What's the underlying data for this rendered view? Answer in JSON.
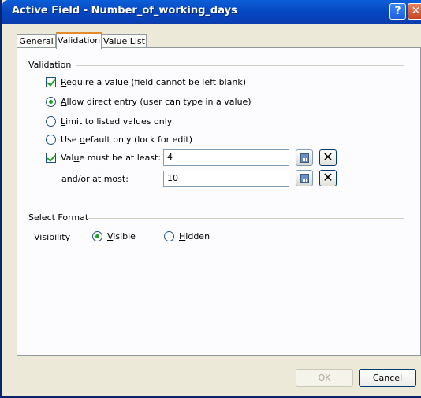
{
  "window": {
    "title": "Active Field - Number_of_working_days",
    "help_label": "?",
    "close_label": "✕"
  },
  "tabs": [
    {
      "label": "General",
      "active": false
    },
    {
      "label": "Validation",
      "active": true
    },
    {
      "label": "Value List",
      "active": false
    }
  ],
  "validation": {
    "group_label": "Validation",
    "require_value": {
      "first": "R",
      "rest": "equire a value (field cannot be left blank)",
      "checked": true
    },
    "allow_direct": {
      "first": "A",
      "rest": "llow direct entry (user can type in a value)",
      "checked": true
    },
    "limit_listed": {
      "first": "L",
      "rest": "imit to listed values only",
      "checked": false
    },
    "use_default": {
      "first": "Use ",
      "underlined": "d",
      "rest": "efault only (lock for edit)",
      "checked": false
    },
    "min_value": {
      "first": "Val",
      "underlined": "u",
      "rest": "e must be at least:",
      "checked": true,
      "value": "4"
    },
    "max_value": {
      "label": "and/or at most:",
      "value": "10"
    }
  },
  "format": {
    "group_label": "Select Format",
    "visibility_label": "Visibility",
    "visible": {
      "underlined": "V",
      "rest": "isible",
      "checked": true
    },
    "hidden": {
      "underlined": "H",
      "rest": "idden",
      "checked": false
    }
  },
  "buttons": {
    "ok": "OK",
    "cancel": "Cancel"
  },
  "colors": {
    "titlebar": "#0a46c0",
    "dialog_bg": "#ece9d8",
    "check_green": "#21a121",
    "active_tab_accent": "#e68b2c"
  }
}
